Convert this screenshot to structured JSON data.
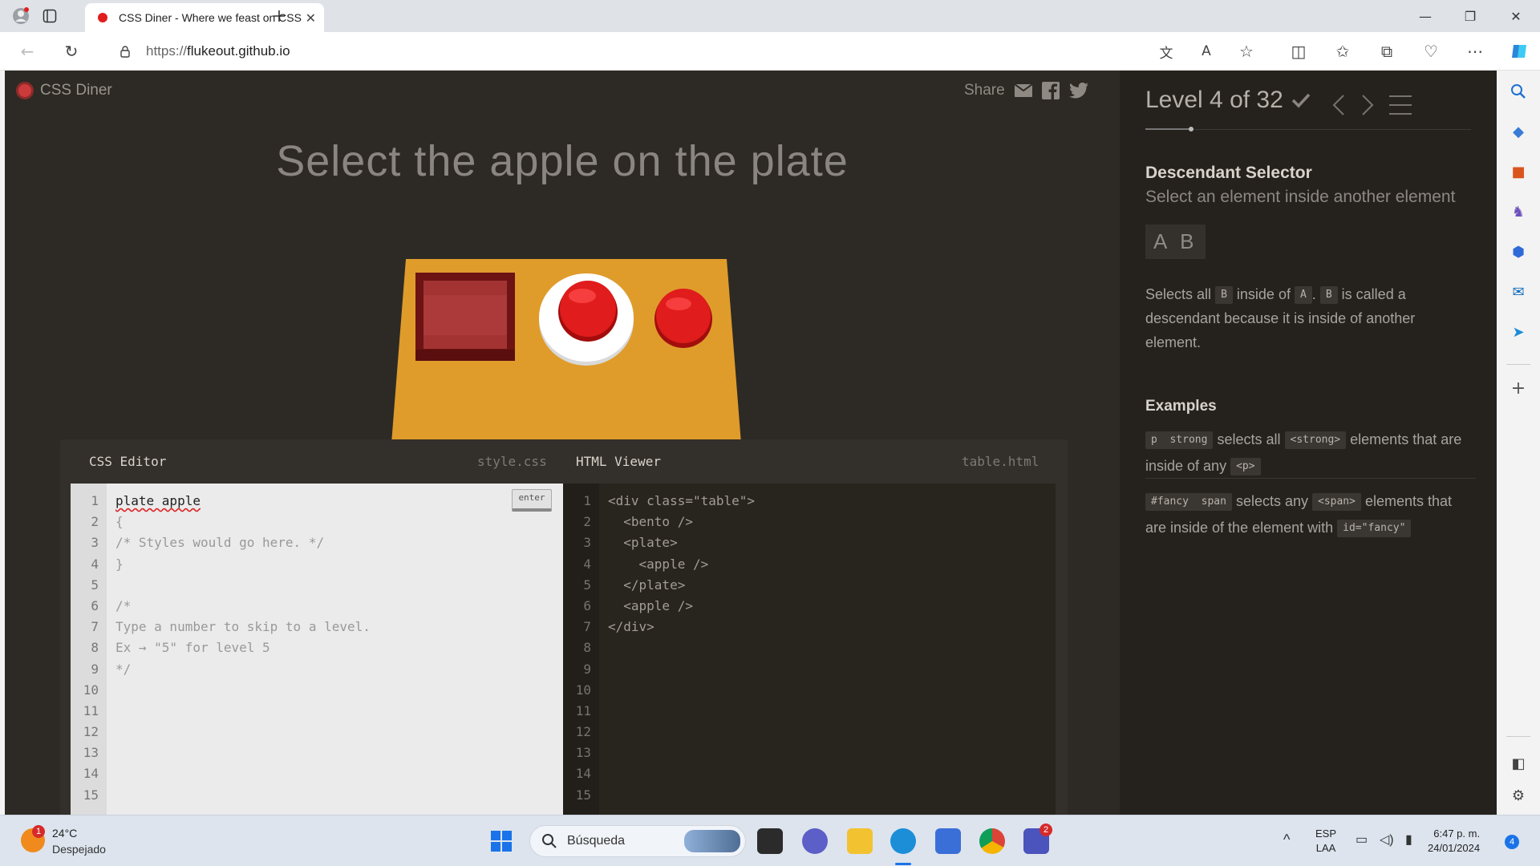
{
  "browser": {
    "tab_title": "CSS Diner - Where we feast on CSS",
    "url_prefix": "https://",
    "url_host": "flukeout.github.io"
  },
  "game": {
    "logo_text": "CSS Diner",
    "share_label": "Share",
    "order": "Select the apple on the plate",
    "css_editor_label": "CSS Editor",
    "css_file": "style.css",
    "html_viewer_label": "HTML Viewer",
    "html_file": "table.html",
    "enter_label": "enter",
    "css_lines": [
      "plate apple",
      "{",
      "/* Styles would go here. */",
      "}",
      "",
      "/*",
      "Type a number to skip to a level.",
      "Ex → \"5\" for level 5",
      "*/",
      "",
      "",
      "",
      "",
      "",
      ""
    ],
    "html_lines": [
      "<div class=\"table\">",
      "  <bento />",
      "  <plate>",
      "    <apple />",
      "  </plate>",
      "  <apple />",
      "</div>",
      "",
      "",
      "",
      "",
      "",
      "",
      "",
      ""
    ],
    "line_numbers": [
      "1",
      "2",
      "3",
      "4",
      "5",
      "6",
      "7",
      "8",
      "9",
      "10",
      "11",
      "12",
      "13",
      "14",
      "15"
    ]
  },
  "level": {
    "title": "Level 4 of 32",
    "selector_name": "Descendant Selector",
    "selector_title": "Select an element inside another element",
    "syntax": "A B",
    "hint_1": "Selects all",
    "hint_chip_b": "B",
    "hint_2": "inside of",
    "hint_chip_a": "A",
    "hint_3": ".",
    "hint_4": "is called a descendant because it is inside of another element.",
    "examples_title": "Examples",
    "ex1_code": "p  strong",
    "ex1_text_1": "selects all",
    "ex1_chip": "<strong>",
    "ex1_text_2": "elements that are inside of any",
    "ex1_chip_2": "<p>",
    "ex2_code": "#fancy  span",
    "ex2_text_1": "selects any",
    "ex2_chip": "<span>",
    "ex2_text_2": "elements that are inside of the element with",
    "ex2_chip_2": "id=\"fancy\""
  },
  "taskbar": {
    "temp": "24°C",
    "weather": "Despejado",
    "weather_badge": "1",
    "search_placeholder": "Búsqueda",
    "lang_1": "ESP",
    "lang_2": "LAA",
    "time": "6:47 p. m.",
    "date": "24/01/2024",
    "notif_count": "4",
    "teams_badge": "2"
  },
  "colors": {
    "accent_red": "#e21d1d",
    "page_bg": "#2d2a25",
    "panel_bg": "#25221e"
  }
}
